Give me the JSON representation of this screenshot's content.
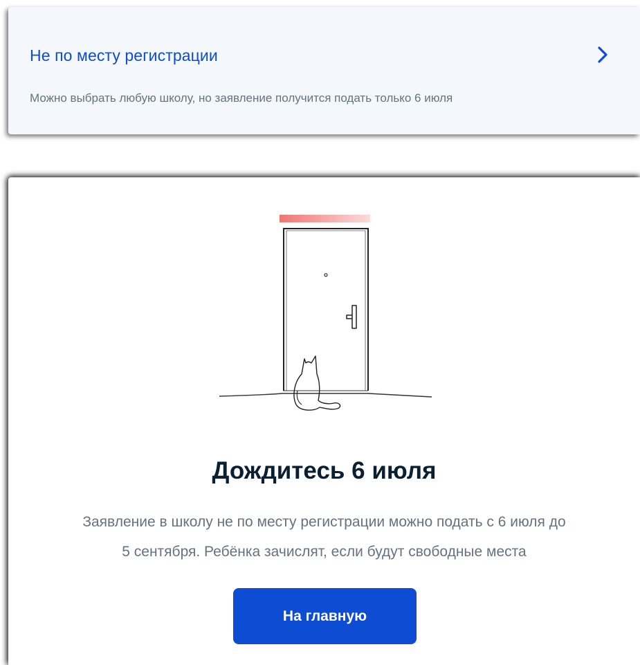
{
  "option": {
    "title": "Не по месту регистрации",
    "description": "Можно выбрать любую школу, но заявление получится подать только 6 июля",
    "icon": "chevron-right-icon"
  },
  "info": {
    "illustration": "door-with-cat-illustration",
    "title": "Дождитесь 6 июля",
    "description_line1": "Заявление в школу не по месту регистрации можно подать с 6 июля до",
    "description_line2": "5 сентября. Ребёнка зачислят, если будут свободные места",
    "button_label": "На главную"
  },
  "colors": {
    "accent": "#0d4cd3",
    "title_text": "#0b1f33",
    "secondary_text": "#66727f",
    "card_bg": "#f4f7fc",
    "illustration_glow": "#f06d6d"
  }
}
